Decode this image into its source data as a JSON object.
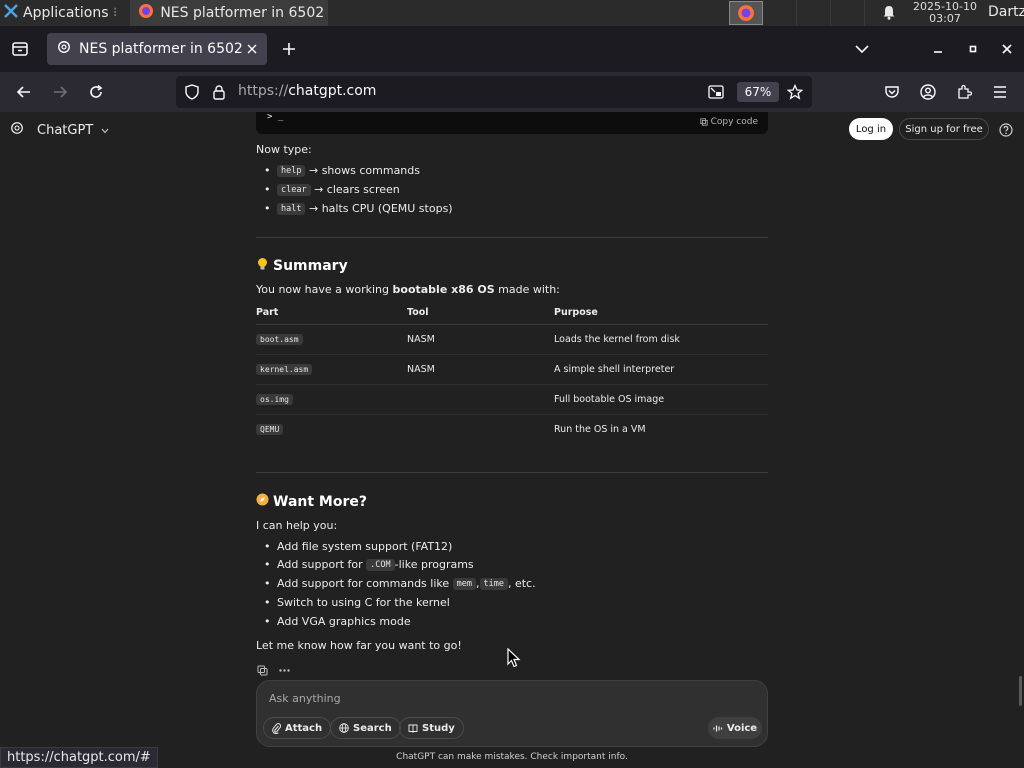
{
  "taskbar": {
    "applications_label": "Applications",
    "window_title": "NES platformer in 6502 ...",
    "clock_date": "2025-10-10",
    "clock_time": "03:07",
    "user": "Dartz"
  },
  "browser": {
    "tab_title": "NES platformer in 6502",
    "url_scheme": "https://",
    "url_host": "chatgpt.com",
    "zoom": "67%",
    "status_url": "https://chatgpt.com/#"
  },
  "header": {
    "brand": "ChatGPT",
    "login": "Log in",
    "signup": "Sign up for free"
  },
  "content": {
    "code_prompt": "> _",
    "copy_code": "Copy code",
    "now_type": "Now type:",
    "commands": [
      {
        "code": "help",
        "text": "→ shows commands"
      },
      {
        "code": "clear",
        "text": "→ clears screen"
      },
      {
        "code": "halt",
        "text": "→ halts CPU (QEMU stops)"
      }
    ],
    "summary_heading": "Summary",
    "summary_intro_pre": "You now have a working ",
    "summary_intro_bold": "bootable x86 OS",
    "summary_intro_post": " made with:",
    "table": {
      "headers": [
        "Part",
        "Tool",
        "Purpose"
      ],
      "rows": [
        {
          "part": "boot.asm",
          "tool": "NASM",
          "purpose": "Loads the kernel from disk"
        },
        {
          "part": "kernel.asm",
          "tool": "NASM",
          "purpose": "A simple shell interpreter"
        },
        {
          "part": "os.img",
          "tool": "",
          "purpose": "Full bootable OS image"
        },
        {
          "part": "QEMU",
          "tool": "",
          "purpose": "Run the OS in a VM"
        }
      ]
    },
    "want_more_heading": "Want More?",
    "help_intro": "I can help you:",
    "more": {
      "item1": "Add file system support (FAT12)",
      "item2_pre": "Add support for ",
      "item2_code": ".COM",
      "item2_post": "-like programs",
      "item3_pre": "Add support for commands like ",
      "item3_code1": "mem",
      "item3_sep": ", ",
      "item3_code2": "time",
      "item3_post": ", etc.",
      "item4": "Switch to using C for the kernel",
      "item5": "Add VGA graphics mode"
    },
    "closing": "Let me know how far you want to go!"
  },
  "composer": {
    "placeholder": "Ask anything",
    "attach": "Attach",
    "search": "Search",
    "study": "Study",
    "voice": "Voice"
  },
  "disclaimer": "ChatGPT can make mistakes. Check important info."
}
